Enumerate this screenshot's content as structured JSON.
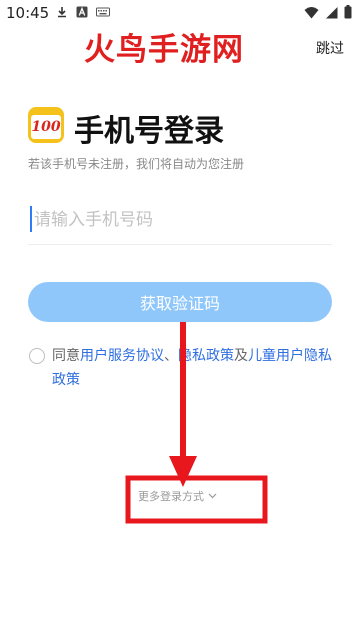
{
  "status_bar": {
    "time": "10:45",
    "left_icons": [
      "download-icon",
      "a-badge-icon",
      "keyboard-icon"
    ],
    "right_icons": [
      "wifi-icon",
      "signal-icon",
      "battery-icon"
    ]
  },
  "watermark": {
    "text": "火鸟手游网",
    "color": "#e02020"
  },
  "header": {
    "skip_label": "跳过"
  },
  "logo": {
    "text": "100"
  },
  "title": "手机号登录",
  "subtitle": "若该手机号未注册，我们将自动为您注册",
  "phone_input": {
    "placeholder": "请输入手机号码",
    "value": ""
  },
  "get_code_button": {
    "label": "获取验证码",
    "color": "#8fc7fb"
  },
  "agreement": {
    "prefix": "同意",
    "user_agreement": "用户服务协议",
    "sep1": "、",
    "privacy_policy": "隐私政策",
    "sep2": "及",
    "child_policy": "儿童用户隐私政策",
    "link_color": "#2f6fe0"
  },
  "more_login": {
    "label": "更多登录方式"
  },
  "annotation": {
    "color": "#e8171d"
  }
}
